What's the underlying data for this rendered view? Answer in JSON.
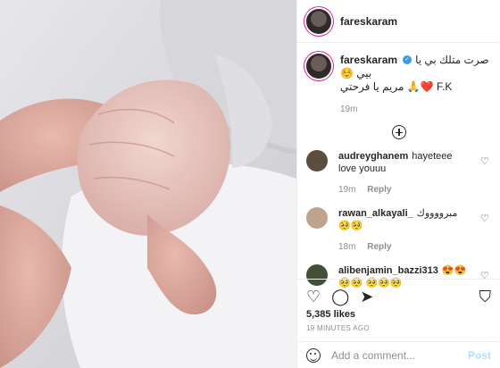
{
  "colors": {
    "brand": "#0095f6",
    "muted": "#8e8e8e",
    "text": "#262626"
  },
  "post": {
    "username": "fareskaram",
    "caption": {
      "username": "fareskaram",
      "line1": "صرت متلك بي يا بيي ☺️",
      "line2": "مريم يا فرحتي 🙏❤️ F.K",
      "age": "19m"
    },
    "comments": [
      {
        "username": "audreyghanem",
        "text": "hayeteee love youuu",
        "age": "19m",
        "reply": "Reply",
        "avatar": "#5b4e3e"
      },
      {
        "username": "rawan_alkayali_",
        "text": "مبرووووك 🥺🥺",
        "age": "18m",
        "reply": "Reply",
        "avatar": "#bfa38b"
      },
      {
        "username": "alibenjamin_bazzi313",
        "text": "😍😍🥺🥺 🥺🥺🥺",
        "age": "",
        "reply": "",
        "avatar": "#444f3a"
      }
    ],
    "likes": "5,385 likes",
    "timestamp": "19 MINUTES AGO",
    "add_comment_placeholder": "Add a comment...",
    "post_label": "Post",
    "icons": [
      "heart-icon",
      "comment-icon",
      "share-icon",
      "save-icon",
      "emoji-icon",
      "plus-icon"
    ]
  }
}
